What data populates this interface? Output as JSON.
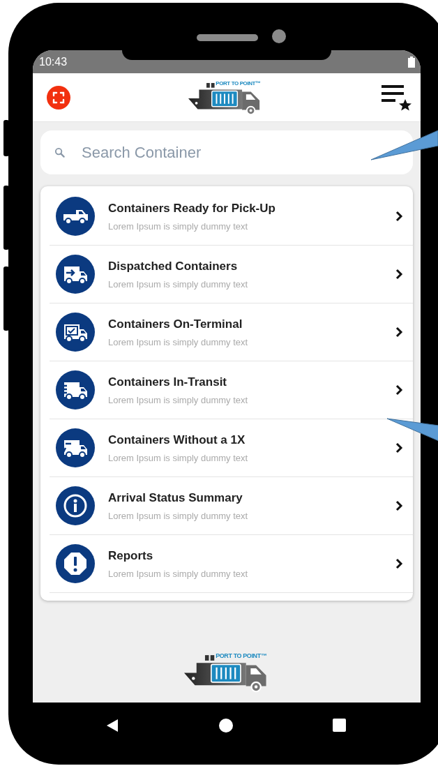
{
  "status_bar": {
    "time": "10:43"
  },
  "header": {
    "logo_text": "PORT TO POINT™"
  },
  "search": {
    "placeholder": "Search Container"
  },
  "menu_items": [
    {
      "title": "Containers Ready for Pick-Up",
      "subtitle": "Lorem Ipsum is simply dummy text"
    },
    {
      "title": "Dispatched Containers",
      "subtitle": "Lorem Ipsum is simply dummy text"
    },
    {
      "title": "Containers On-Terminal",
      "subtitle": "Lorem Ipsum is simply dummy text"
    },
    {
      "title": "Containers In-Transit",
      "subtitle": "Lorem Ipsum is simply dummy text"
    },
    {
      "title": "Containers Without a 1X",
      "subtitle": "Lorem Ipsum is simply dummy text"
    },
    {
      "title": "Arrival Status Summary",
      "subtitle": "Lorem Ipsum is simply dummy text"
    },
    {
      "title": "Reports",
      "subtitle": "Lorem Ipsum is simply dummy text"
    }
  ],
  "footer": {
    "logo_text": "PORT TO POINT™"
  }
}
